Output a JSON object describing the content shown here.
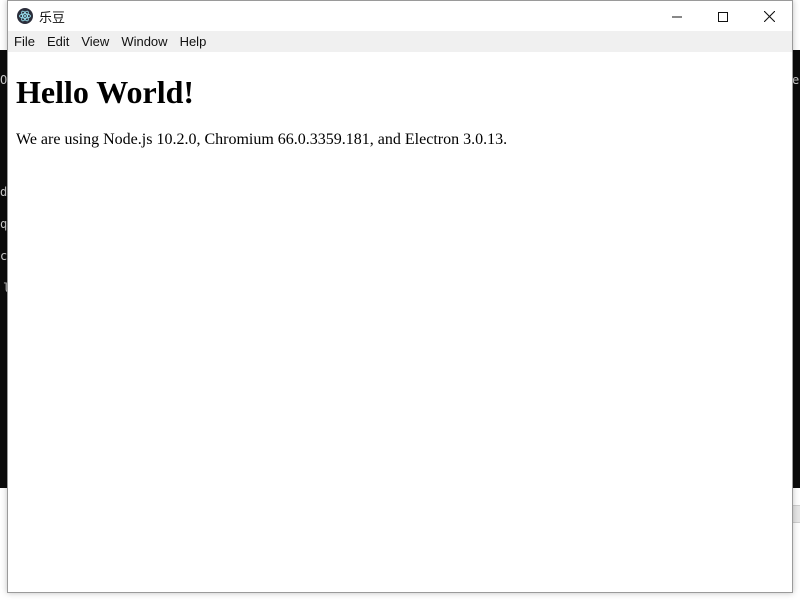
{
  "window": {
    "title": "乐豆",
    "controls": {
      "minimize_icon": "minimize-icon",
      "maximize_icon": "maximize-icon",
      "close_icon": "close-icon"
    }
  },
  "menubar": {
    "items": [
      {
        "label": "File"
      },
      {
        "label": "Edit"
      },
      {
        "label": "View"
      },
      {
        "label": "Window"
      },
      {
        "label": "Help"
      }
    ]
  },
  "content": {
    "heading": "Hello World!",
    "paragraph_prefix": "We are using Node.js ",
    "node_version": "10.2.0",
    "chromium_label": ", Chromium ",
    "chromium_version": "66.0.3359.181",
    "electron_label": ", and Electron ",
    "electron_version": "3.0.13",
    "paragraph_suffix": "."
  },
  "background": {
    "fragments": [
      "Ol",
      "d",
      "q",
      "cl",
      "l",
      "e"
    ]
  },
  "colors": {
    "titlebar": "#ffffff",
    "menubar": "#f0f0f0",
    "background_terminal": "#0c0c0c"
  }
}
